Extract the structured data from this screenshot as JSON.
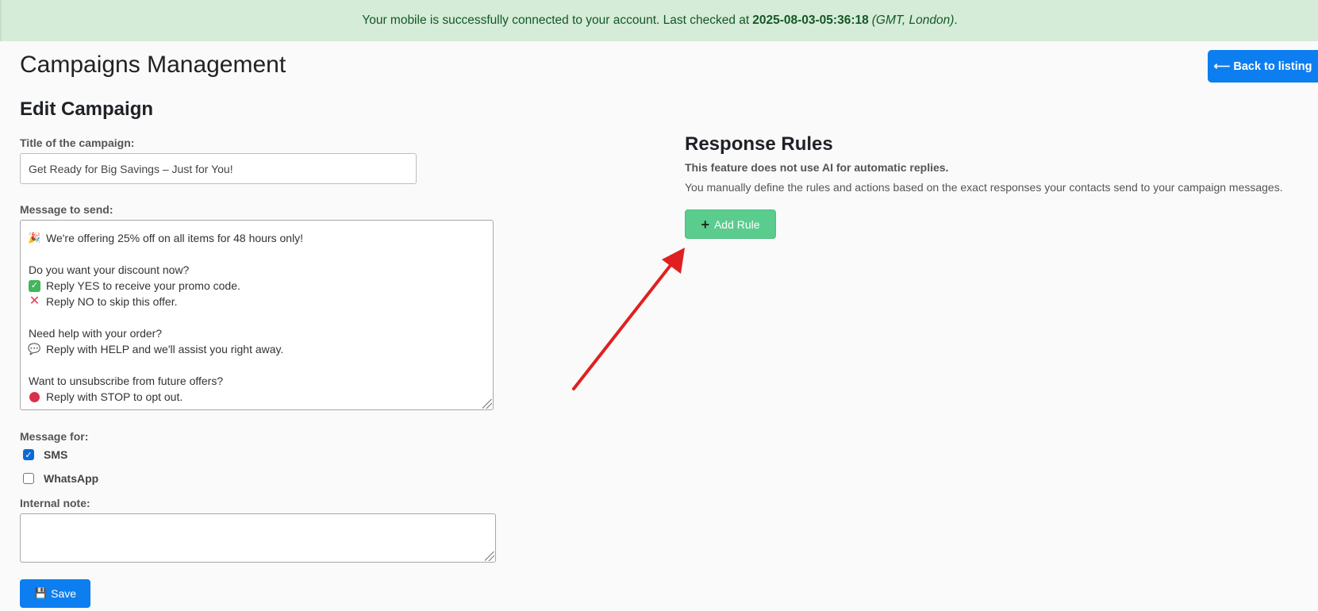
{
  "banner": {
    "text_before": "Your mobile is successfully connected to your account. Last checked at",
    "timestamp": "2025-08-03-05:36:18",
    "timezone": "(GMT, London)",
    "suffix": "."
  },
  "page_title": "Campaigns Management",
  "back_button": {
    "label": "⟵ Back to listing"
  },
  "form": {
    "heading": "Edit Campaign",
    "title_label": "Title of the campaign:",
    "title_value": "Get Ready for Big Savings – Just for You!",
    "message_label": "Message to send:",
    "message_lines": [
      {
        "icon": "party-popper",
        "text": "We're offering 25% off on all items for 48 hours only!"
      },
      {
        "icon": "",
        "text": ""
      },
      {
        "icon": "",
        "text": "Do you want your discount now?"
      },
      {
        "icon": "check-mark",
        "text": "Reply YES to receive your promo code."
      },
      {
        "icon": "cross-mark",
        "text": "Reply NO to skip this offer."
      },
      {
        "icon": "",
        "text": ""
      },
      {
        "icon": "",
        "text": "Need help with your order?"
      },
      {
        "icon": "speech-bubble",
        "text": "Reply with HELP and we'll assist you right away."
      },
      {
        "icon": "",
        "text": ""
      },
      {
        "icon": "",
        "text": "Want to unsubscribe from future offers?"
      },
      {
        "icon": "stop-sign",
        "text": "Reply with STOP to opt out."
      }
    ],
    "message_for_label": "Message for:",
    "channels": [
      {
        "label": "SMS",
        "checked": true
      },
      {
        "label": "WhatsApp",
        "checked": false
      }
    ],
    "note_label": "Internal note:",
    "note_value": "",
    "save_label": "Save"
  },
  "rules": {
    "heading": "Response Rules",
    "bold_note": "This feature does not use AI for automatic replies.",
    "description": "You manually define the rules and actions based on the exact responses your contacts send to your campaign messages.",
    "add_button": "Add Rule"
  },
  "colors": {
    "banner_bg": "#d5ecd9",
    "banner_text": "#155724",
    "primary": "#0d7ef0",
    "success": "#5acc8d",
    "arrow": "#e02020"
  }
}
